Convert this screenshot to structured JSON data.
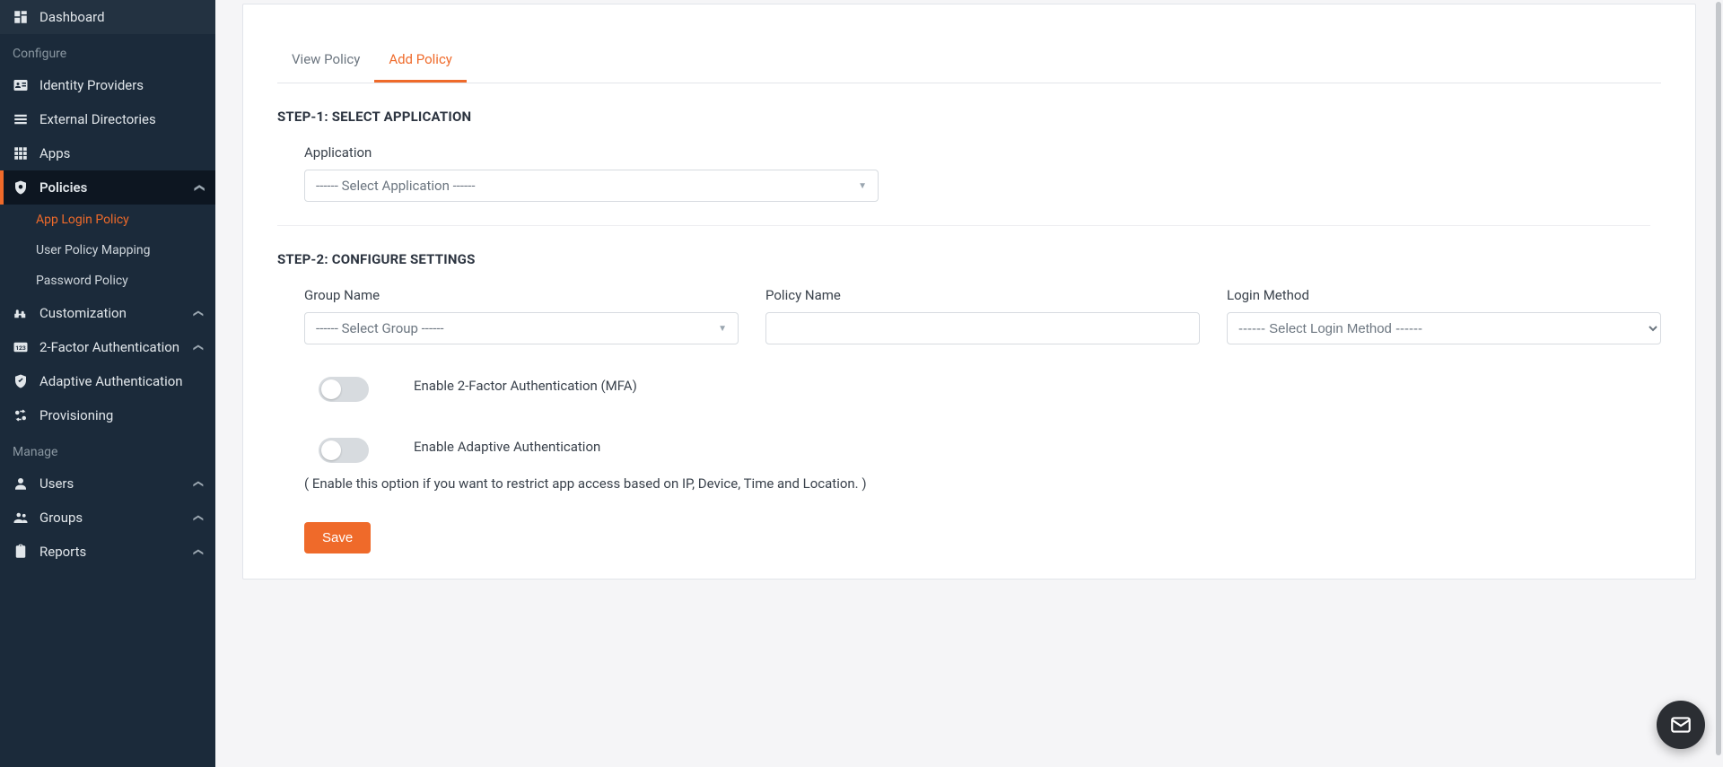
{
  "sidebar": {
    "sections": {
      "configure": "Configure",
      "manage": "Manage"
    },
    "items": {
      "dashboard": "Dashboard",
      "identity_providers": "Identity Providers",
      "external_directories": "External Directories",
      "apps": "Apps",
      "policies": "Policies",
      "app_login_policy": "App Login Policy",
      "user_policy_mapping": "User Policy Mapping",
      "password_policy": "Password Policy",
      "customization": "Customization",
      "two_factor": "2-Factor Authentication",
      "adaptive_auth": "Adaptive Authentication",
      "provisioning": "Provisioning",
      "users": "Users",
      "groups": "Groups",
      "reports": "Reports"
    }
  },
  "tabs": {
    "view_policy": "View Policy",
    "add_policy": "Add Policy"
  },
  "step1": {
    "title": "STEP-1: SELECT APPLICATION",
    "application_label": "Application",
    "application_placeholder": "------ Select Application ------"
  },
  "step2": {
    "title": "STEP-2: CONFIGURE SETTINGS",
    "group_label": "Group Name",
    "group_placeholder": "------ Select Group ------",
    "policy_label": "Policy Name",
    "policy_value": "",
    "login_method_label": "Login Method",
    "login_method_placeholder": "------ Select Login Method ------",
    "mfa_label": "Enable 2-Factor Authentication (MFA)",
    "adaptive_label": "Enable Adaptive Authentication",
    "adaptive_desc": "( Enable this option if you want to restrict app access based on IP, Device, Time and Location. )"
  },
  "buttons": {
    "save": "Save"
  }
}
